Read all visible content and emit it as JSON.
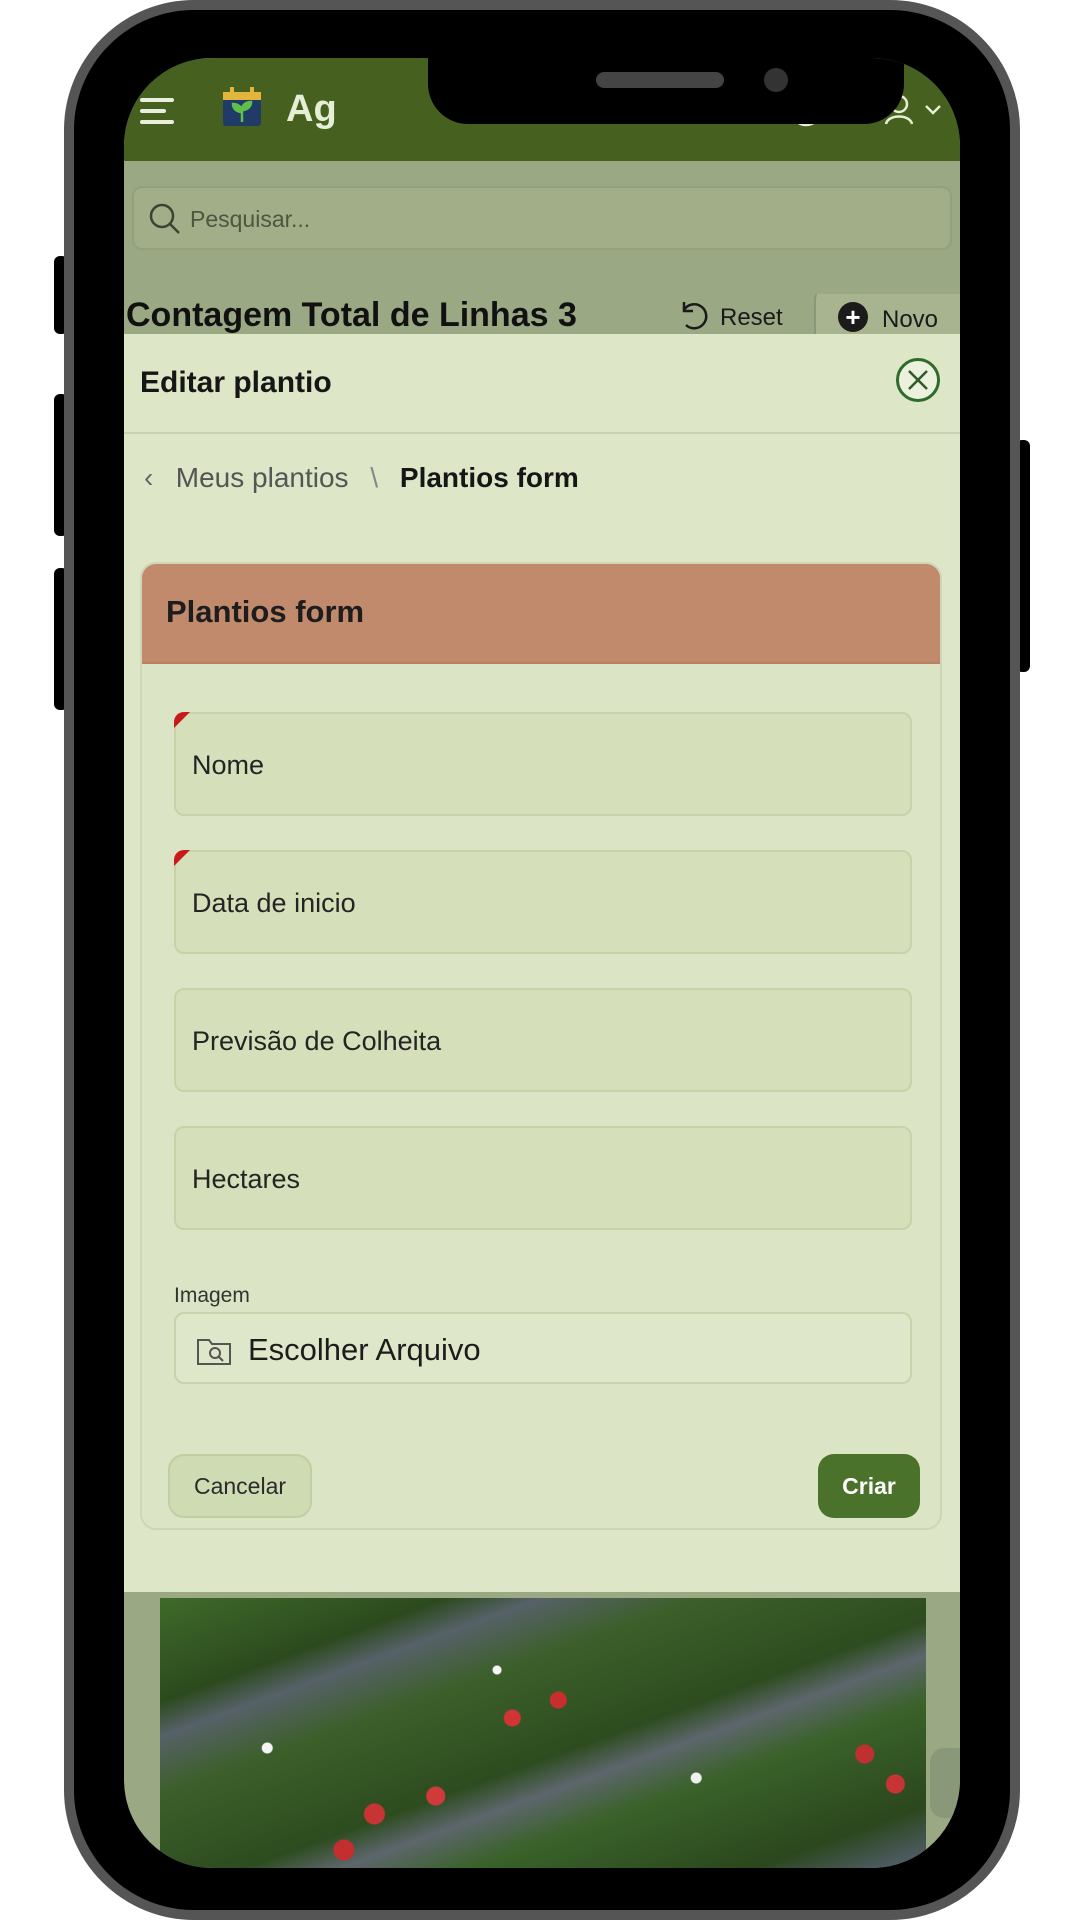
{
  "header": {
    "app_title": "Ag",
    "help_icon": "help-circle-icon",
    "user_icon": "user-icon"
  },
  "search": {
    "placeholder": "Pesquisar..."
  },
  "list": {
    "title": "Contagem Total de Linhas 3",
    "reset_label": "Reset",
    "new_label": "Novo"
  },
  "modal": {
    "title": "Editar plantio",
    "breadcrumb": {
      "parent": "Meus plantios",
      "separator": "\\",
      "current": "Plantios form"
    },
    "form": {
      "title": "Plantios form",
      "fields": [
        {
          "label": "Nome",
          "required": true
        },
        {
          "label": "Data de inicio",
          "required": true
        },
        {
          "label": "Previsão de Colheita",
          "required": false
        },
        {
          "label": "Hectares",
          "required": false
        }
      ],
      "image_label": "Imagem",
      "file_button": "Escolher Arquivo",
      "cancel_label": "Cancelar",
      "submit_label": "Criar"
    }
  },
  "colors": {
    "header_bg": "#45601f",
    "modal_bg": "#dde6c7",
    "form_header_bg": "#c28a6d",
    "primary_button": "#4a722a",
    "required_marker": "#c81a1a"
  }
}
